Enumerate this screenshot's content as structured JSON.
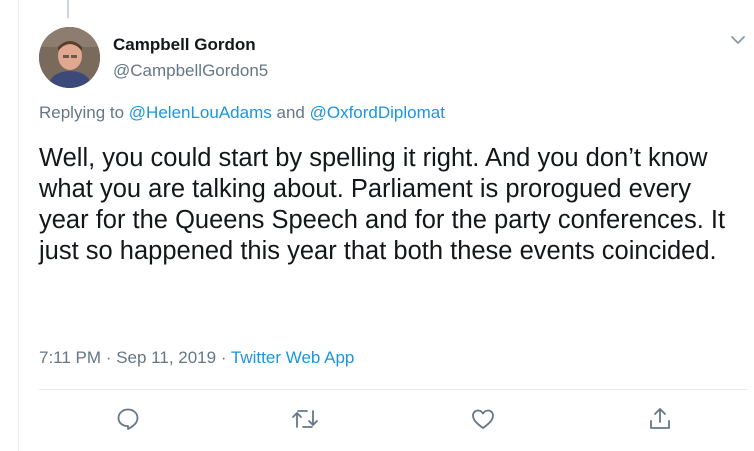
{
  "tweet": {
    "author_name": "Campbell Gordon",
    "author_handle": "@CampbellGordon5",
    "replying_prefix": "Replying to",
    "replying_to": [
      "@HelenLouAdams",
      "@OxfordDiplomat"
    ],
    "replying_conjunction": "and",
    "text": "Well, you could start by spelling it right. And you don’t know what you are talking about. Parliament is prorogued every year for the Queens Speech and for the party conferences. It just so happened this year that both these events coincided.",
    "time": "7:11 PM",
    "separator": "·",
    "date": "Sep 11, 2019",
    "source": "Twitter Web App"
  },
  "actions": [
    "reply-icon",
    "retweet-icon",
    "like-icon",
    "share-icon"
  ],
  "colors": {
    "link": "#1b95e0",
    "muted": "#657786",
    "text": "#14171a",
    "divider": "#e6ecf0"
  }
}
